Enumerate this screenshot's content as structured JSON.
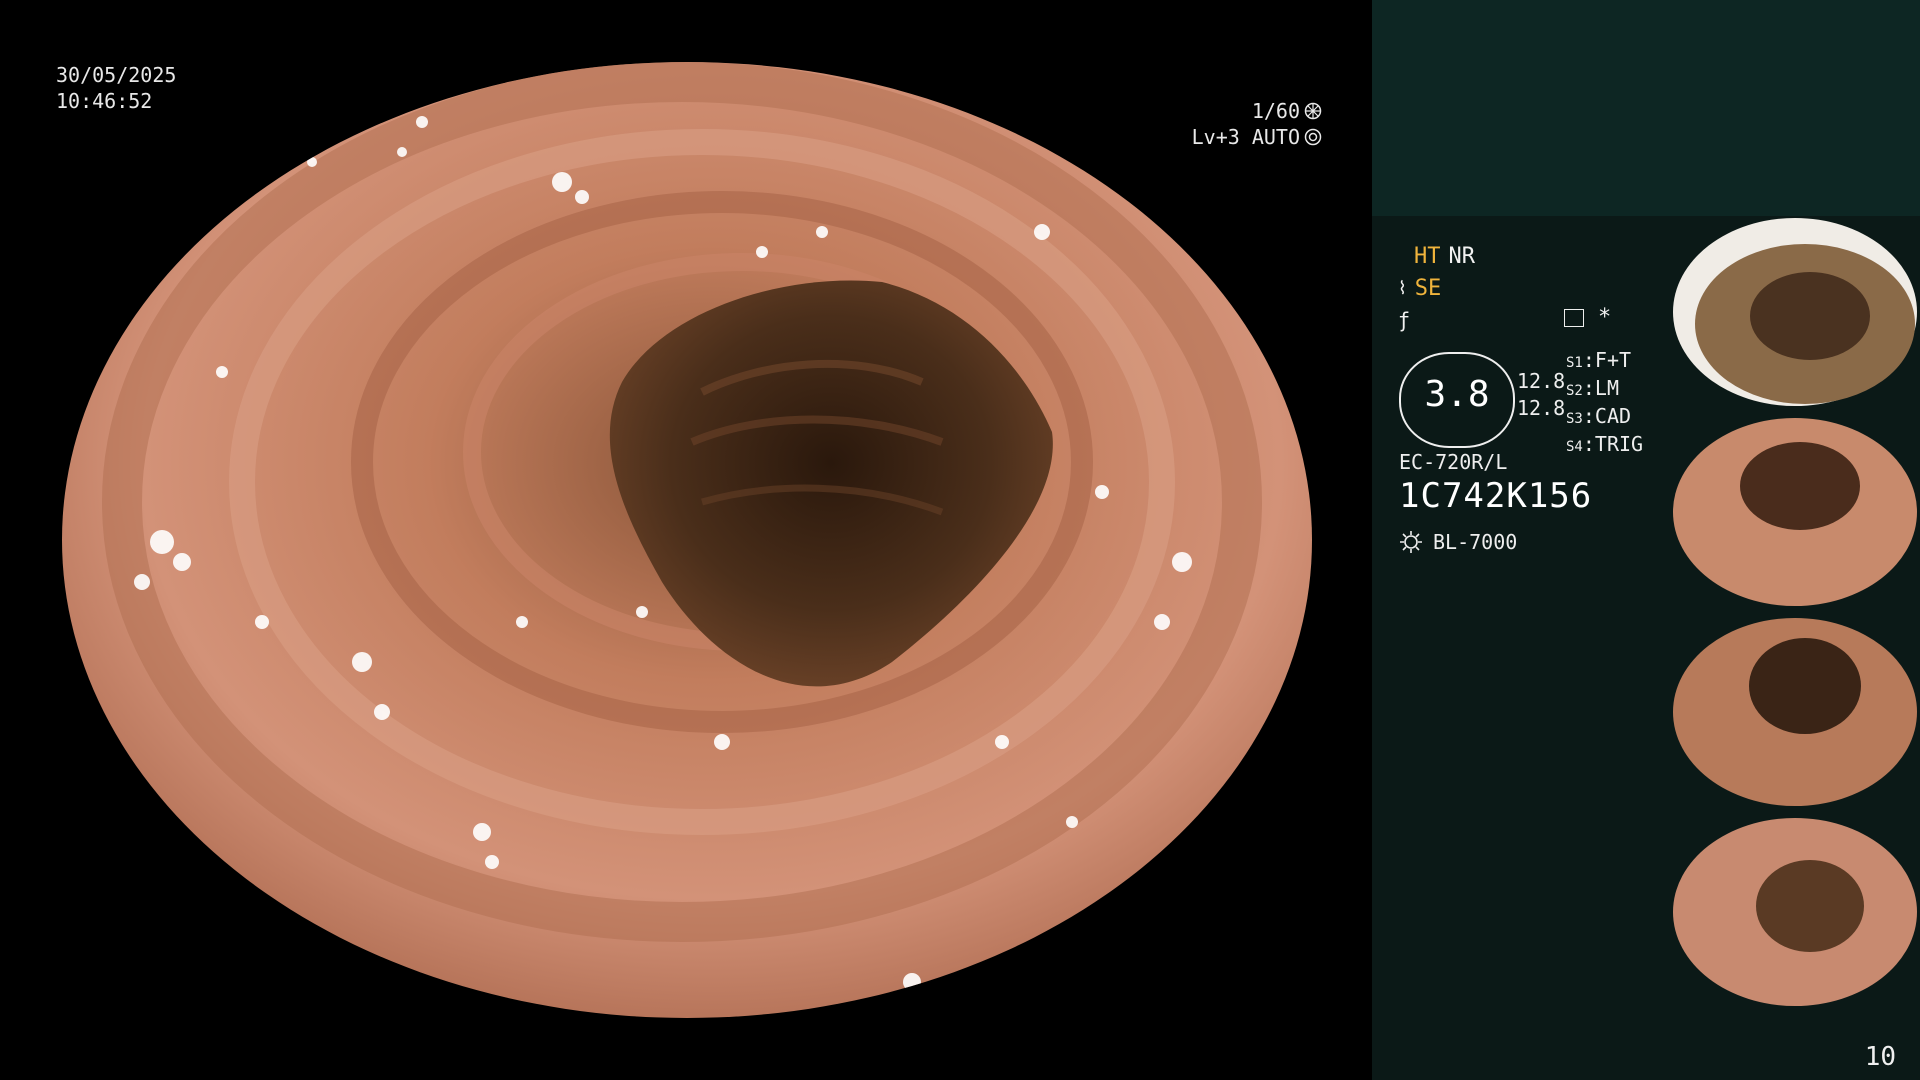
{
  "video": {
    "date": "30/05/2025",
    "time": "10:46:52",
    "shutter": "1/60",
    "exposure": "Lv+3 AUTO"
  },
  "panel": {
    "ht_label": "HT",
    "nr_label": "NR",
    "se_label": "SE",
    "asterisk": "*",
    "gauge_value": "3.8",
    "gauge_num_1": "12.8",
    "gauge_num_2": "12.8",
    "switches": [
      {
        "key": "S1",
        "value": "F+T"
      },
      {
        "key": "S2",
        "value": "LM"
      },
      {
        "key": "S3",
        "value": "CAD"
      },
      {
        "key": "S4",
        "value": "TRIG"
      }
    ],
    "scope_model": "EC-720R/L",
    "scope_serial": "1C742K156",
    "light_source": "BL-7000"
  },
  "page_number": "10",
  "colors": {
    "panel_bg": "#0b1917",
    "panel_top_bg": "#0d2623",
    "accent_orange": "#f0b43c",
    "mucosa": "#c07a5c",
    "lumen": "#3a2415"
  }
}
